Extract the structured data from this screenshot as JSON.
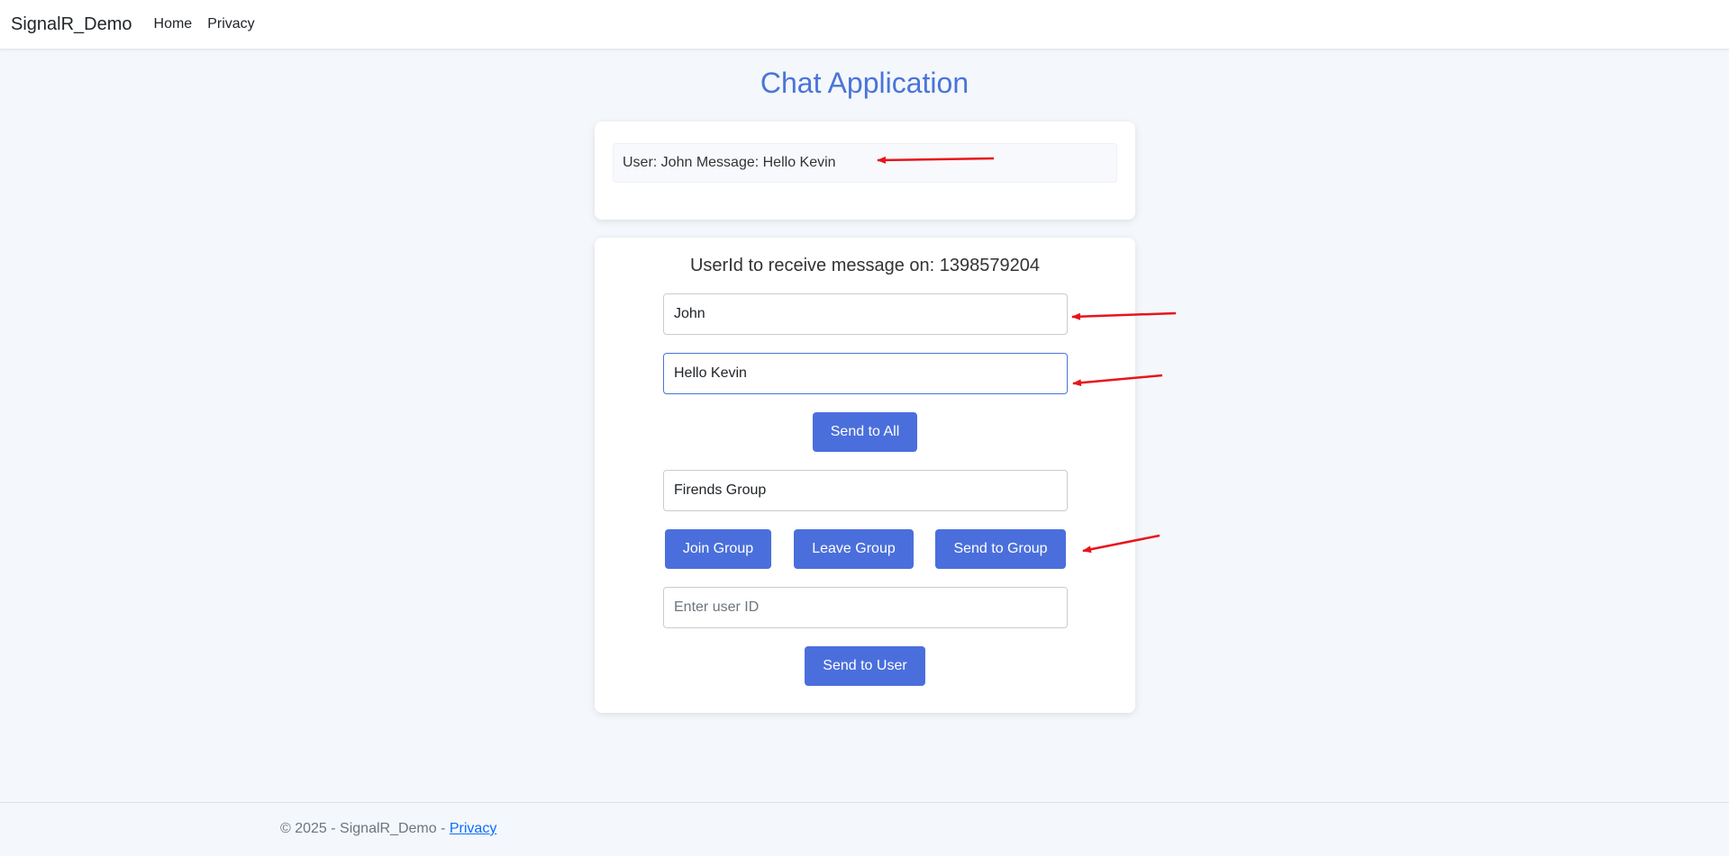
{
  "navbar": {
    "brand": "SignalR_Demo",
    "links": [
      "Home",
      "Privacy"
    ]
  },
  "page": {
    "title": "Chat Application"
  },
  "messages": [
    "User: John Message: Hello Kevin"
  ],
  "controls": {
    "userid_line": "UserId to receive message on: 1398579204",
    "user_input_value": "John",
    "message_input_value": "Hello Kevin",
    "send_all_label": "Send to All",
    "group_input_value": "Firends Group",
    "join_group_label": "Join Group",
    "leave_group_label": "Leave Group",
    "send_group_label": "Send to Group",
    "target_user_placeholder": "Enter user ID",
    "send_user_label": "Send to User"
  },
  "footer": {
    "text": "© 2025 - SignalR_Demo - ",
    "privacy_link": "Privacy"
  },
  "colors": {
    "accent": "#4a74d9",
    "button": "#4a6fdc",
    "annotation_arrow": "#e8141b"
  }
}
